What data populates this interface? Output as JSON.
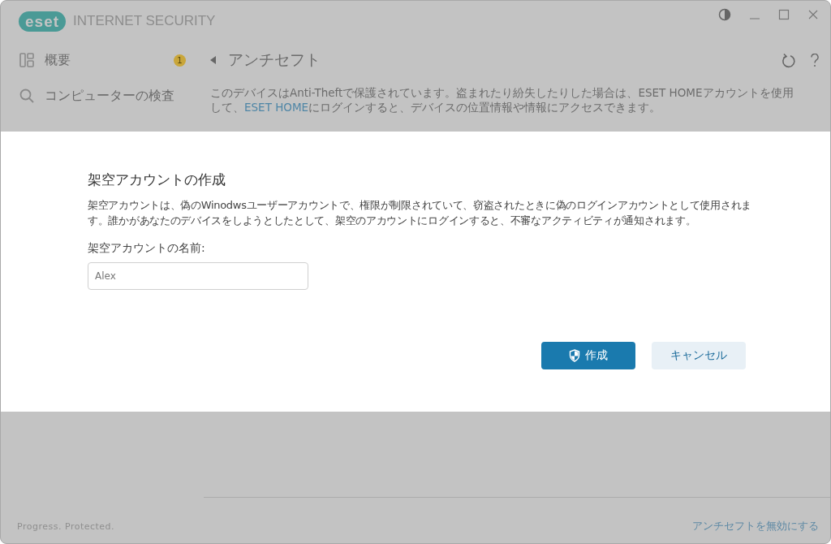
{
  "window": {
    "logo": "eset",
    "title": "INTERNET SECURITY"
  },
  "sidebar": {
    "items": [
      {
        "kind": "overview",
        "label": "概要",
        "badge": "1"
      },
      {
        "kind": "scan",
        "label": "コンピューターの検査"
      }
    ]
  },
  "page": {
    "title": "アンチセフト",
    "description": {
      "before": "このデバイスはAnti-Theftで保護されています。盗まれたり紛失したりした場合は、ESET HOMEアカウントを使用して、",
      "link": "ESET HOME",
      "after": "にログインすると、デバイスの位置情報や情報にアクセスできます。"
    }
  },
  "dialog": {
    "title": "架空アカウントの作成",
    "text": "架空アカウントは、偽のWinodwsユーザーアカウントで、権限が制限されていて、窃盗されたときに偽のログインアカウントとして使用されます。誰かがあなたのデバイスをしようとしたとして、架空のアカウントにログインすると、不審なアクティビティが通知されます。",
    "field_label": "架空アカウントの名前:",
    "field": {
      "placeholder": "Alex"
    },
    "buttons": [
      {
        "kind": "primary",
        "label": "作成"
      },
      {
        "kind": "secondary",
        "label": "キャンセル"
      }
    ]
  },
  "footer": {
    "tagline": "Progress. Protected.",
    "link": "アンチセフトを無効にする"
  }
}
